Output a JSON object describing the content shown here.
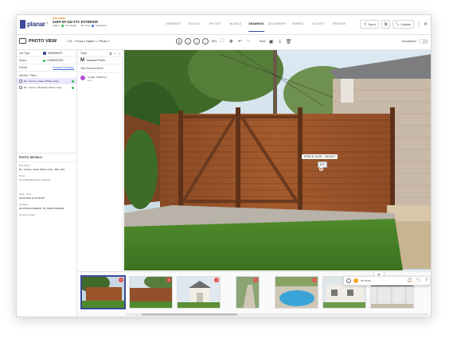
{
  "app": {
    "logo": "planar",
    "logo_sub": "SITE SCANS"
  },
  "project": {
    "badge": "PRO DEMO",
    "title": "24SP-SF-GD-TYC EXTERIOR",
    "status_label": "Status",
    "status_value": "Completed",
    "jobtype_label": "Job Type",
    "jobtype_value": "SnapshotJ"
  },
  "nav": [
    "SNAPSHOT",
    "DETAILS",
    "PHOTOS",
    "MODELS",
    "DRAWINGS",
    "DOCUMENTS",
    "SHARES",
    "ACTIVITY",
    "PREVIEW"
  ],
  "nav_active_index": 4,
  "top_actions": {
    "export_label": "Export",
    "collapse_label": "Collapse"
  },
  "toolbar": {
    "title": "PHOTO VIEW",
    "breadcrumb": "E1 - Fence | Gates >> Photo 1",
    "zoom": "18%",
    "tools_label": "Tools",
    "annotations_label": "Annotations"
  },
  "left": {
    "job_type_label": "Job Type",
    "job_type_value": "SNAPSHOT",
    "status_label": "Status",
    "status_value": "COMPLETED",
    "details_label": "Details",
    "details_link": "Product Summary",
    "albums_label": "Albums / Plans",
    "albums": [
      {
        "label": "E1 - Fence | Gates (Photo only)",
        "selected": true
      },
      {
        "label": "E2 - Doors | Windows (Photo only)",
        "selected": false
      }
    ],
    "photo_details_title": "PHOTO DETAILS",
    "fields": [
      {
        "label": "File Name",
        "value": "E1 - Fence | Gates (Photo only) - IMG_001"
      },
      {
        "label": "Notes",
        "value": "No embedded photo selected"
      },
      {
        "label": "Date / Time",
        "value": "09.03.2024 at 10:18 AM"
      },
      {
        "label": "Location",
        "value": "30.27403147394818, -97.7843174495229"
      },
      {
        "label": "Camera Height",
        "value": ""
      }
    ]
  },
  "tools_panel": {
    "tools_label": "Tools",
    "measure_label": "Measure Photo",
    "take_label": "Take Measurements",
    "measurement": {
      "title": "Length / Distance /",
      "sub": "Line"
    }
  },
  "photo": {
    "annotation_label": "FENCE GATE - HEIGHT",
    "annotation_value": "6' 2\""
  },
  "floatbar": {
    "time": "00:45 PM"
  },
  "thumbnails": [
    {
      "name": "fence-gate",
      "selected": true
    },
    {
      "name": "fence-side",
      "selected": false
    },
    {
      "name": "shed",
      "selected": false
    },
    {
      "name": "walkway",
      "selected": false
    },
    {
      "name": "pool",
      "selected": false
    },
    {
      "name": "house-front",
      "selected": false
    },
    {
      "name": "patio",
      "selected": false
    }
  ],
  "colors": {
    "brand": "#3b4a9a",
    "success": "#2eb84b",
    "danger": "#e54b4b",
    "selection": "#ebe7ff"
  }
}
